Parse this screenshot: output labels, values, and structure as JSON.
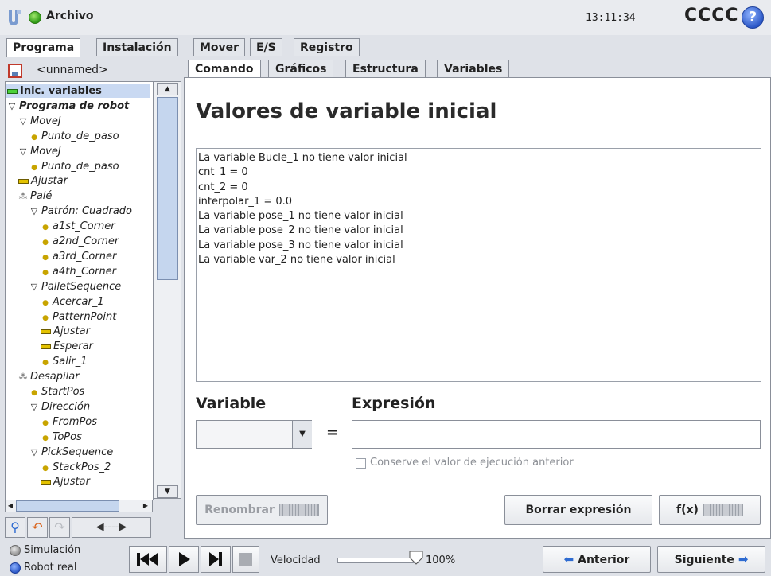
{
  "header": {
    "file_menu": "Archivo",
    "time": "13:11:34",
    "robot_name": "CCCC",
    "help": "?"
  },
  "top_tabs": [
    "Programa",
    "Instalación",
    "Mover",
    "E/S",
    "Registro"
  ],
  "program": {
    "name": "<unnamed>"
  },
  "tree": [
    {
      "label": "Inic. variables",
      "indent": 0,
      "icon": "bar-green",
      "selected": true,
      "bold": true,
      "italic": false
    },
    {
      "label": "Programa de robot",
      "indent": 0,
      "icon": "triangle",
      "bold": true
    },
    {
      "label": "MoveJ",
      "indent": 1,
      "icon": "triangle"
    },
    {
      "label": "Punto_de_paso",
      "indent": 2,
      "icon": "dot"
    },
    {
      "label": "MoveJ",
      "indent": 1,
      "icon": "triangle"
    },
    {
      "label": "Punto_de_paso",
      "indent": 2,
      "icon": "dot"
    },
    {
      "label": "Ajustar",
      "indent": 1,
      "icon": "bar"
    },
    {
      "label": "Palé",
      "indent": 1,
      "icon": "pallet"
    },
    {
      "label": "Patrón: Cuadrado",
      "indent": 2,
      "icon": "triangle"
    },
    {
      "label": "a1st_Corner",
      "indent": 3,
      "icon": "dot"
    },
    {
      "label": "a2nd_Corner",
      "indent": 3,
      "icon": "dot"
    },
    {
      "label": "a3rd_Corner",
      "indent": 3,
      "icon": "dot"
    },
    {
      "label": "a4th_Corner",
      "indent": 3,
      "icon": "dot"
    },
    {
      "label": "PalletSequence",
      "indent": 2,
      "icon": "triangle"
    },
    {
      "label": "Acercar_1",
      "indent": 3,
      "icon": "dot"
    },
    {
      "label": "PatternPoint",
      "indent": 3,
      "icon": "dot"
    },
    {
      "label": "Ajustar",
      "indent": 3,
      "icon": "bar"
    },
    {
      "label": "Esperar",
      "indent": 3,
      "icon": "bar"
    },
    {
      "label": "Salir_1",
      "indent": 3,
      "icon": "dot"
    },
    {
      "label": "Desapilar",
      "indent": 1,
      "icon": "pallet"
    },
    {
      "label": "StartPos",
      "indent": 2,
      "icon": "dot"
    },
    {
      "label": "Dirección",
      "indent": 2,
      "icon": "triangle"
    },
    {
      "label": "FromPos",
      "indent": 3,
      "icon": "dot"
    },
    {
      "label": "ToPos",
      "indent": 3,
      "icon": "dot"
    },
    {
      "label": "PickSequence",
      "indent": 2,
      "icon": "triangle"
    },
    {
      "label": "StackPos_2",
      "indent": 3,
      "icon": "dot"
    },
    {
      "label": "Ajustar",
      "indent": 3,
      "icon": "bar"
    }
  ],
  "sub_tabs": [
    "Comando",
    "Gráficos",
    "Estructura",
    "Variables"
  ],
  "main": {
    "title": "Valores de variable inicial",
    "variables": [
      "La variable Bucle_1 no tiene valor inicial",
      "cnt_1 = 0",
      "cnt_2 = 0",
      "interpolar_1 = 0.0",
      "La variable pose_1 no tiene valor inicial",
      "La variable pose_2 no tiene valor inicial",
      "La variable pose_3 no tiene valor inicial",
      "La variable var_2 no tiene valor inicial"
    ],
    "variable_label": "Variable",
    "equals": "=",
    "expression_label": "Expresión",
    "variable_value": "",
    "expression_value": "",
    "keep_label": "Conserve el valor de ejecución anterior",
    "rename_label": "Renombrar",
    "clear_label": "Borrar expresión",
    "fx_label": "f(x)"
  },
  "footer": {
    "simulation": "Simulación",
    "real_robot": "Robot real",
    "speed_label": "Velocidad",
    "speed_value": "100%",
    "speed_fraction": 1.0,
    "prev_label": "Anterior",
    "next_label": "Siguiente"
  }
}
